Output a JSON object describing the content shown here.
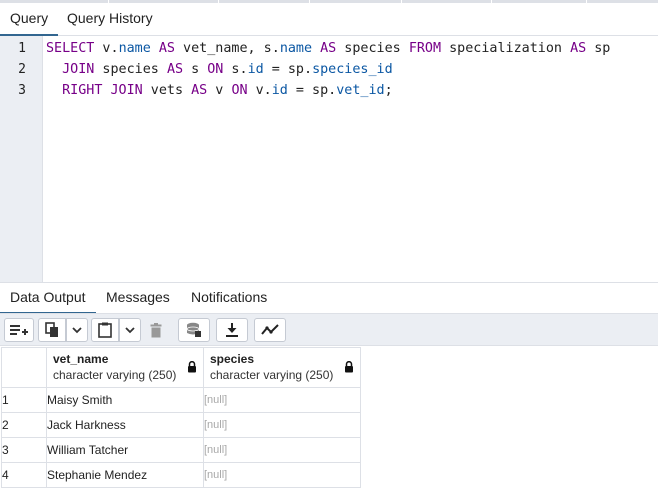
{
  "query_tabs": [
    {
      "label": "Query",
      "active": true
    },
    {
      "label": "Query History",
      "active": false
    }
  ],
  "editor": {
    "line_numbers": [
      "1",
      "2",
      "3"
    ],
    "lines": [
      [
        {
          "t": "SELECT",
          "c": "kw"
        },
        {
          "t": " v.",
          "c": ""
        },
        {
          "t": "name",
          "c": "prop"
        },
        {
          "t": " ",
          "c": ""
        },
        {
          "t": "AS",
          "c": "kw"
        },
        {
          "t": " vet_name, s.",
          "c": ""
        },
        {
          "t": "name",
          "c": "prop"
        },
        {
          "t": " ",
          "c": ""
        },
        {
          "t": "AS",
          "c": "kw"
        },
        {
          "t": " species ",
          "c": ""
        },
        {
          "t": "FROM",
          "c": "kw"
        },
        {
          "t": " specialization ",
          "c": ""
        },
        {
          "t": "AS",
          "c": "kw"
        },
        {
          "t": " sp",
          "c": ""
        }
      ],
      [
        {
          "t": "  ",
          "c": ""
        },
        {
          "t": "JOIN",
          "c": "kw"
        },
        {
          "t": " species ",
          "c": ""
        },
        {
          "t": "AS",
          "c": "kw"
        },
        {
          "t": " s ",
          "c": ""
        },
        {
          "t": "ON",
          "c": "kw"
        },
        {
          "t": " s.",
          "c": ""
        },
        {
          "t": "id",
          "c": "prop"
        },
        {
          "t": " = sp.",
          "c": ""
        },
        {
          "t": "species_id",
          "c": "prop"
        }
      ],
      [
        {
          "t": "  ",
          "c": ""
        },
        {
          "t": "RIGHT JOIN",
          "c": "kw"
        },
        {
          "t": " vets ",
          "c": ""
        },
        {
          "t": "AS",
          "c": "kw"
        },
        {
          "t": " v ",
          "c": ""
        },
        {
          "t": "ON",
          "c": "kw"
        },
        {
          "t": " v.",
          "c": ""
        },
        {
          "t": "id",
          "c": "prop"
        },
        {
          "t": " = sp.",
          "c": ""
        },
        {
          "t": "vet_id",
          "c": "prop"
        },
        {
          "t": ";",
          "c": ""
        }
      ]
    ]
  },
  "output_tabs": [
    {
      "label": "Data Output",
      "active": true
    },
    {
      "label": "Messages",
      "active": false
    },
    {
      "label": "Notifications",
      "active": false
    }
  ],
  "toolbar": {
    "icons": [
      "add-row-icon",
      "copy-icon",
      "dropdown-icon",
      "paste-icon",
      "dropdown-icon",
      "delete-icon",
      "save-data-icon",
      "download-icon",
      "graph-icon"
    ]
  },
  "results": {
    "columns": [
      {
        "name": "vet_name",
        "type": "character varying (250)",
        "icon": "lock-icon"
      },
      {
        "name": "species",
        "type": "character varying (250)",
        "icon": "lock-icon"
      }
    ],
    "rows": [
      {
        "num": "1",
        "vet_name": "Maisy Smith",
        "species": "[null]"
      },
      {
        "num": "2",
        "vet_name": "Jack Harkness",
        "species": "[null]"
      },
      {
        "num": "3",
        "vet_name": "William Tatcher",
        "species": "[null]"
      },
      {
        "num": "4",
        "vet_name": "Stephanie Mendez",
        "species": "[null]"
      }
    ]
  },
  "colors": {
    "keyword": "#770088",
    "property": "#0b57a3",
    "active_tab_underline": "#326690",
    "null_text": "#a8a8a8"
  }
}
